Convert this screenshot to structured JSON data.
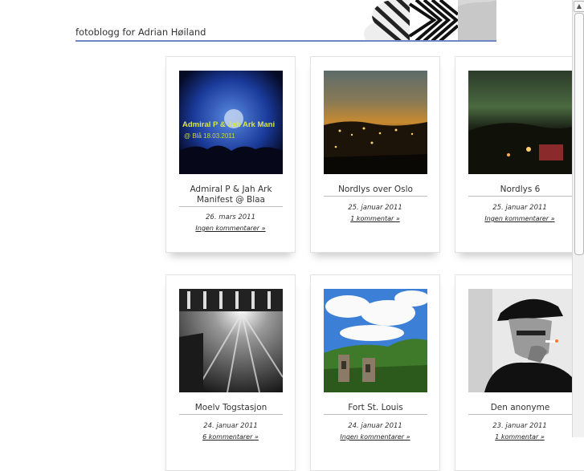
{
  "site": {
    "title": "fotoblogg for Adrian Høiland"
  },
  "header_art": {
    "icon": "zebra-pattern-banner"
  },
  "posts": [
    {
      "title": "Admiral P & Jah Ark Manifest @ Blaa",
      "date": "26. mars 2011",
      "comments": "Ingen kommentarer »",
      "image_caption": "Admiral P & Jah Ark Mani",
      "image_caption2": "@ Blå 18.03.2011"
    },
    {
      "title": "Nordlys over Oslo",
      "date": "25. januar 2011",
      "comments": "1 kommentar »"
    },
    {
      "title": "Nordlys 6",
      "date": "25. januar 2011",
      "comments": "Ingen kommentarer »"
    },
    {
      "title": "Moelv Togstasjon",
      "date": "24. januar 2011",
      "comments": "6 kommentarer »"
    },
    {
      "title": "Fort St. Louis",
      "date": "24. januar 2011",
      "comments": "Ingen kommentarer »"
    },
    {
      "title": "Den anonyme",
      "date": "23. januar 2011",
      "comments": "1 kommentar »"
    }
  ],
  "scrollbar": {
    "up_icon": "▲"
  }
}
